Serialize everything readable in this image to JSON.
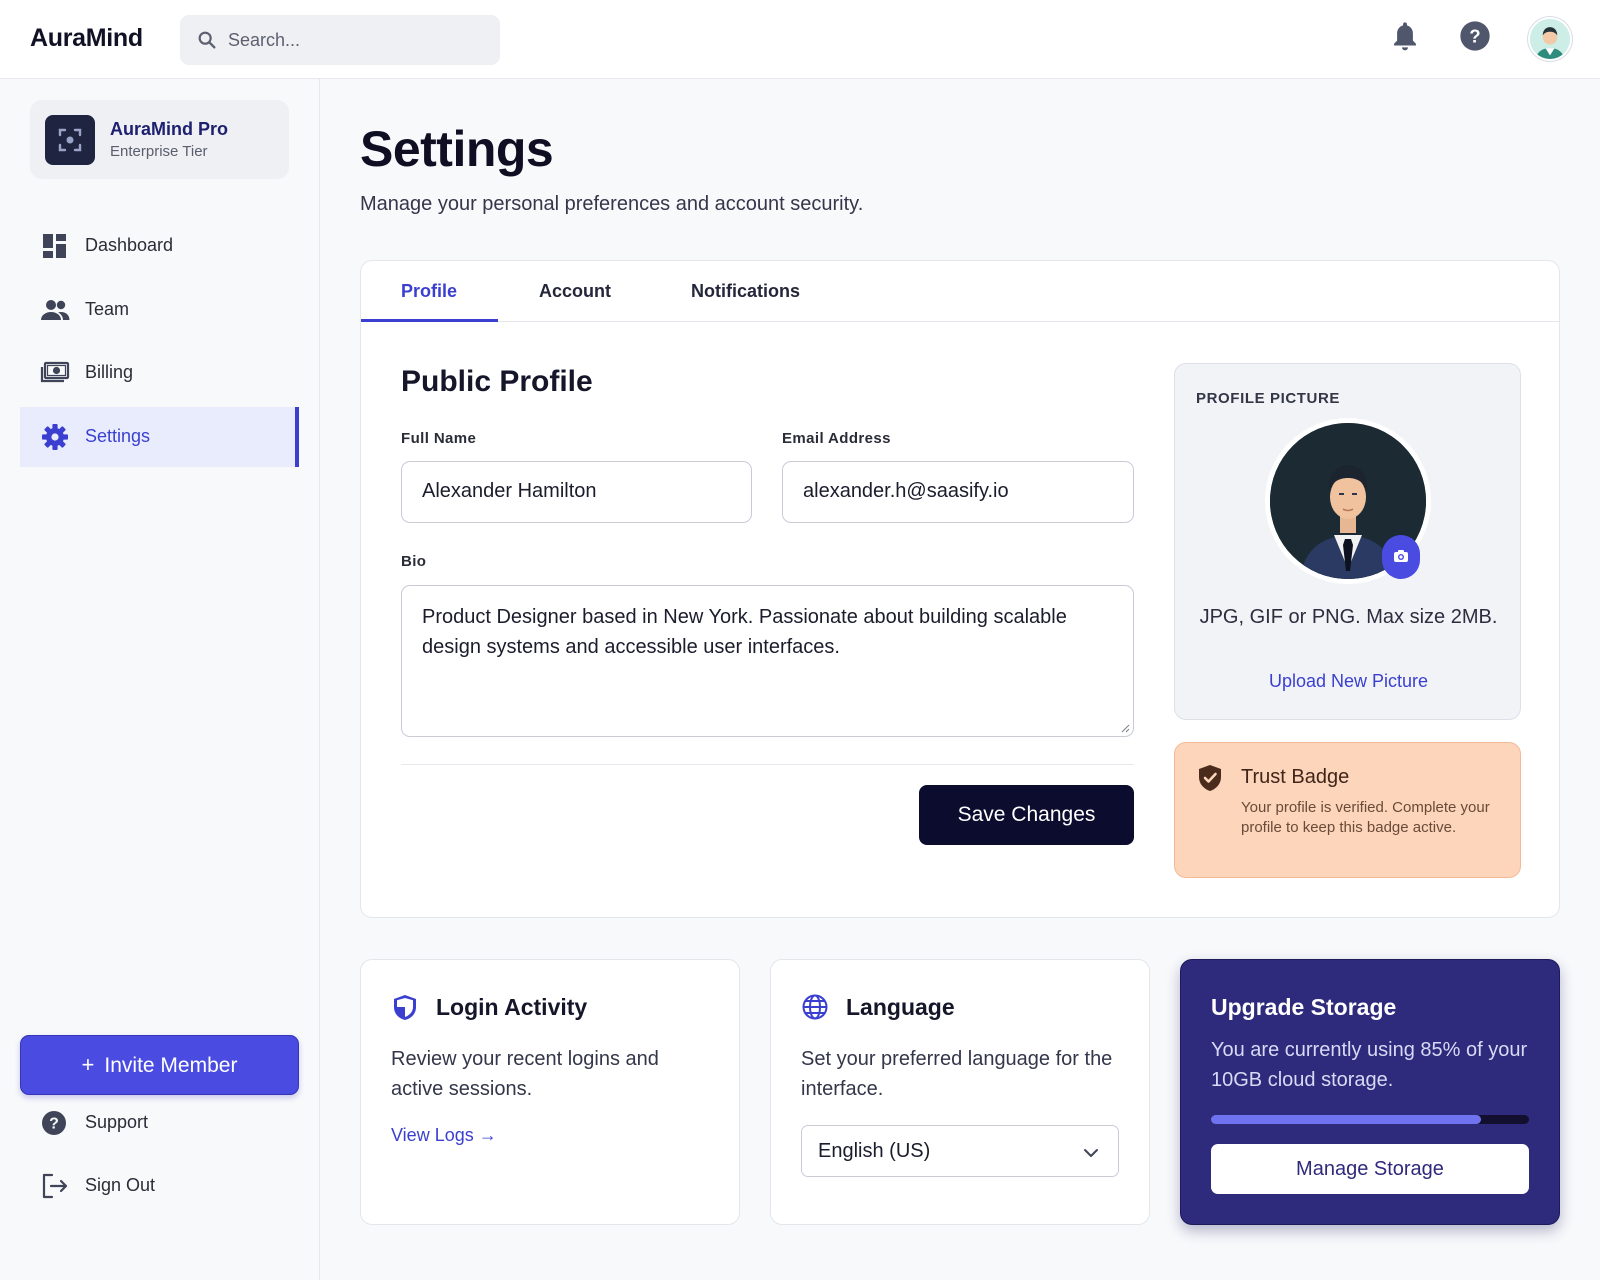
{
  "topbar": {
    "brand": "AuraMind",
    "search_placeholder": "Search...",
    "icons": [
      "search-icon",
      "bell-icon",
      "help-icon",
      "avatar"
    ]
  },
  "sidebar": {
    "org_name": "AuraMind Pro",
    "org_tier": "Enterprise Tier",
    "items": [
      {
        "label": "Dashboard",
        "icon": "dashboard-icon",
        "active": false
      },
      {
        "label": "Team",
        "icon": "team-icon",
        "active": false
      },
      {
        "label": "Billing",
        "icon": "billing-icon",
        "active": false
      },
      {
        "label": "Settings",
        "icon": "gear-icon",
        "active": true
      }
    ],
    "invite_label": "Invite Member",
    "footer_items": [
      {
        "label": "Support",
        "icon": "help-icon"
      },
      {
        "label": "Sign Out",
        "icon": "sign-out-icon"
      }
    ]
  },
  "page": {
    "title": "Settings",
    "subtitle": "Manage your personal preferences and account security."
  },
  "tabs": [
    {
      "label": "Profile",
      "active": true
    },
    {
      "label": "Account",
      "active": false
    },
    {
      "label": "Notifications",
      "active": false
    }
  ],
  "profile": {
    "section_title": "Public Profile",
    "full_name_label": "Full Name",
    "full_name_value": "Alexander Hamilton",
    "email_label": "Email Address",
    "email_value": "alexander.h@saasify.io",
    "bio_label": "Bio",
    "bio_value": "Product Designer based in New York. Passionate about building scalable design systems and accessible user interfaces.",
    "save_label": "Save Changes"
  },
  "picture": {
    "label": "PROFILE PICTURE",
    "help": "JPG, GIF or PNG. Max size 2MB.",
    "upload_label": "Upload New Picture"
  },
  "trust": {
    "title": "Trust Badge",
    "description": "Your profile is verified. Complete your profile to keep this badge active."
  },
  "login_activity": {
    "title": "Login Activity",
    "description": "Review your recent logins and active sessions.",
    "link": "View Logs →"
  },
  "language": {
    "title": "Language",
    "description": "Set your preferred language for the interface.",
    "selected": "English (US)"
  },
  "storage": {
    "title": "Upgrade Storage",
    "description": "You are currently using 85% of your 10GB cloud storage.",
    "usage_fraction": 0.85,
    "button_label": "Manage Storage"
  },
  "colors": {
    "accent": "#3b3fd0",
    "button_dark": "#0c0c2e",
    "upgrade_bg": "#2e2a7c",
    "trust_bg": "#fcd5bb"
  }
}
